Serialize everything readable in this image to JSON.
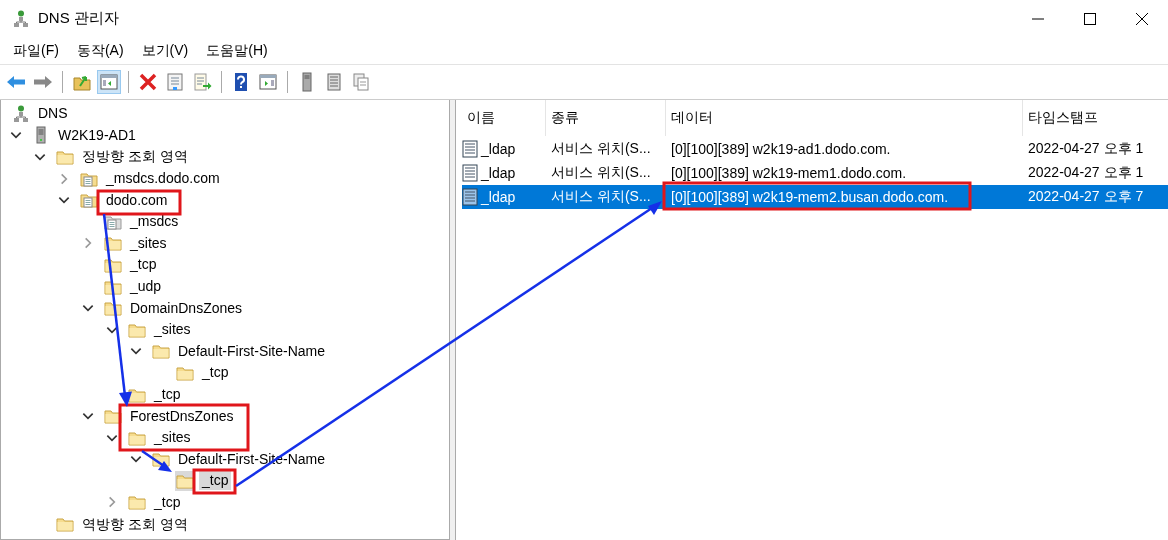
{
  "window": {
    "title": "DNS 관리자"
  },
  "menu": [
    "파일(F)",
    "동작(A)",
    "보기(V)",
    "도움말(H)"
  ],
  "toolbar": [
    {
      "kind": "back",
      "pressed": false
    },
    {
      "kind": "forward",
      "pressed": false
    },
    {
      "kind": "separator"
    },
    {
      "kind": "up",
      "pressed": false
    },
    {
      "kind": "console-tree",
      "pressed": true
    },
    {
      "kind": "separator"
    },
    {
      "kind": "delete",
      "pressed": false
    },
    {
      "kind": "properties",
      "pressed": false
    },
    {
      "kind": "export",
      "pressed": false
    },
    {
      "kind": "separator"
    },
    {
      "kind": "help",
      "pressed": false
    },
    {
      "kind": "action-pane",
      "pressed": false
    },
    {
      "kind": "separator"
    },
    {
      "kind": "server",
      "pressed": false
    },
    {
      "kind": "list",
      "pressed": false
    },
    {
      "kind": "copy",
      "pressed": false
    }
  ],
  "tree": [
    {
      "label": "DNS",
      "kind": "dns",
      "selected": false,
      "children": [
        {
          "label": "W2K19-AD1",
          "kind": "server",
          "selected": false,
          "expanded": true,
          "children": [
            {
              "label": "정방향 조회 영역",
              "kind": "folder",
              "selected": false,
              "expanded": true,
              "children": [
                {
                  "label": "_msdcs.dodo.com",
                  "kind": "zone",
                  "selected": false,
                  "expanded": false
                },
                {
                  "label": "dodo.com",
                  "kind": "zone",
                  "selected": false,
                  "expanded": true,
                  "children": [
                    {
                      "label": "_msdcs",
                      "kind": "delegation",
                      "selected": false
                    },
                    {
                      "label": "_sites",
                      "kind": "folder",
                      "selected": false,
                      "expanded": false
                    },
                    {
                      "label": "_tcp",
                      "kind": "folder",
                      "selected": false
                    },
                    {
                      "label": "_udp",
                      "kind": "folder",
                      "selected": false
                    },
                    {
                      "label": "DomainDnsZones",
                      "kind": "folder",
                      "selected": false,
                      "expanded": true,
                      "children": [
                        {
                          "label": "_sites",
                          "kind": "folder",
                          "selected": false,
                          "expanded": true,
                          "children": [
                            {
                              "label": "Default-First-Site-Name",
                              "kind": "folder",
                              "selected": false,
                              "expanded": true,
                              "children": [
                                {
                                  "label": "_tcp",
                                  "kind": "folder",
                                  "selected": false
                                }
                              ]
                            }
                          ]
                        },
                        {
                          "label": "_tcp",
                          "kind": "folder",
                          "selected": false
                        }
                      ]
                    },
                    {
                      "label": "ForestDnsZones",
                      "kind": "folder",
                      "selected": false,
                      "expanded": true,
                      "children": [
                        {
                          "label": "_sites",
                          "kind": "folder",
                          "selected": false,
                          "expanded": true,
                          "children": [
                            {
                              "label": "Default-First-Site-Name",
                              "kind": "folder",
                              "selected": false,
                              "expanded": true,
                              "children": [
                                {
                                  "label": "_tcp",
                                  "kind": "folder",
                                  "selected": true
                                }
                              ]
                            }
                          ]
                        },
                        {
                          "label": "_tcp",
                          "kind": "folder",
                          "selected": false,
                          "expanded": false
                        }
                      ]
                    }
                  ]
                }
              ]
            },
            {
              "label": "역방향 조회 영역",
              "kind": "folder",
              "selected": false
            }
          ]
        }
      ]
    }
  ],
  "table": {
    "columns": [
      "이름",
      "종류",
      "데이터",
      "타임스탬프"
    ],
    "rows": [
      {
        "name": "_ldap",
        "type": "서비스 위치(S...",
        "data": "[0][100][389] w2k19-ad1.dodo.com.",
        "timestamp": "2022-04-27 오후 1",
        "selected": false
      },
      {
        "name": "_ldap",
        "type": "서비스 위치(S...",
        "data": "[0][100][389] w2k19-mem1.dodo.com.",
        "timestamp": "2022-04-27 오후 1",
        "selected": false
      },
      {
        "name": "_ldap",
        "type": "서비스 위치(S...",
        "data": "[0][100][389] w2k19-mem2.busan.dodo.com.",
        "timestamp": "2022-04-27 오후 7",
        "selected": true
      }
    ]
  }
}
